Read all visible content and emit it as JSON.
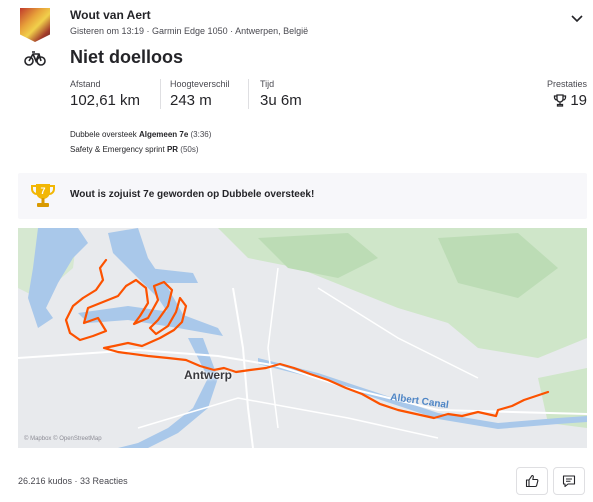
{
  "header": {
    "athlete_name": "Wout van Aert",
    "meta": "Gisteren om 13:19 · Garmin Edge 1050 · Antwerpen, België",
    "expand_icon": "chevron-down-icon"
  },
  "activity": {
    "type_icon": "bike-icon",
    "title": "Niet doelloos"
  },
  "stats": [
    {
      "label": "Afstand",
      "value": "102,61 km"
    },
    {
      "label": "Hoogteverschil",
      "value": "243 m"
    },
    {
      "label": "Tijd",
      "value": "3u 6m"
    }
  ],
  "prestaties": {
    "label": "Prestaties",
    "value": "19",
    "icon": "trophy-icon"
  },
  "segments": [
    {
      "prefix": "Dubbele oversteek ",
      "strong": "Algemeen 7e",
      "suffix": " (3:36)"
    },
    {
      "prefix": "Safety & Emergency sprint ",
      "strong": "PR",
      "suffix": " (50s)"
    }
  ],
  "banner": {
    "badge": "7",
    "text": "Wout is zojuist 7e geworden op Dubbele oversteek!"
  },
  "map": {
    "city_label": "Antwerp",
    "canal_label": "Albert Canal",
    "attribution": "© Mapbox © OpenStreetMap",
    "route_color": "#fc5200"
  },
  "footer": {
    "kudos": "26.216 kudos",
    "separator": " · ",
    "comments": "33 Reacties",
    "like_icon": "thumbs-up-icon",
    "comment_icon": "comment-icon"
  },
  "colors": {
    "brand": "#fc5200",
    "text": "#242428",
    "muted": "#494950",
    "banner_bg": "#f7f7fa",
    "trophy": "#e8a600"
  }
}
